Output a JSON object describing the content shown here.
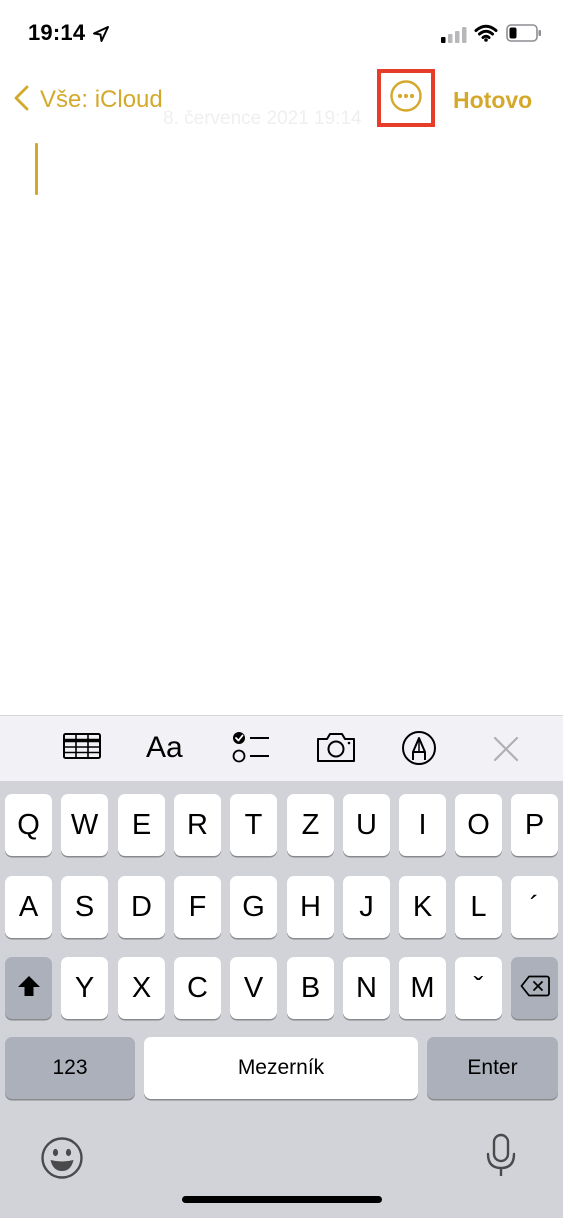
{
  "status_bar": {
    "time": "19:14",
    "icons": [
      "location-arrow-icon",
      "cellular-signal-icon",
      "wifi-icon",
      "battery-icon"
    ]
  },
  "nav": {
    "back_label": "Vše: iCloud",
    "date_text": "8. července 2021 19:14",
    "more_icon": "ellipsis-circle-icon",
    "done_label": "Hotovo"
  },
  "toolbar": {
    "icons": [
      "table-icon",
      "text-format-icon",
      "checklist-icon",
      "camera-icon",
      "markup-pen-icon",
      "close-icon"
    ],
    "format_label": "Aa"
  },
  "keyboard": {
    "row1": [
      "Q",
      "W",
      "E",
      "R",
      "T",
      "Z",
      "U",
      "I",
      "O",
      "P"
    ],
    "row2": [
      "A",
      "S",
      "D",
      "F",
      "G",
      "H",
      "J",
      "K",
      "L",
      "´"
    ],
    "row3": [
      "Y",
      "X",
      "C",
      "V",
      "B",
      "N",
      "M",
      "ˇ"
    ],
    "numbers_label": "123",
    "space_label": "Mezerník",
    "enter_label": "Enter"
  },
  "colors": {
    "accent": "#d4a92b",
    "highlight_box": "#e53d2a",
    "keyboard_bg": "#d1d3d8",
    "toolbar_bg": "#f2f2f6"
  }
}
